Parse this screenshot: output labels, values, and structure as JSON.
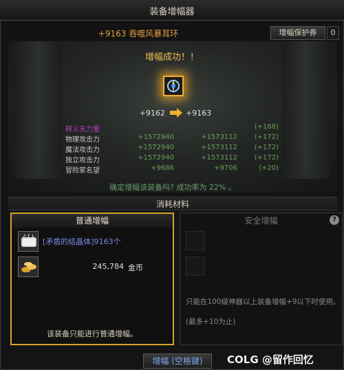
{
  "window": {
    "title": "装备增幅器"
  },
  "item": {
    "name": "+9163 吞噬风暴耳环",
    "success_text": "增幅成功！！",
    "level_old": "+9162",
    "level_new": "+9163"
  },
  "protect": {
    "label": "增幅保护券",
    "count": "0"
  },
  "stats": [
    {
      "name": "释义无力量",
      "old": "",
      "new": "",
      "diff": "(+168)"
    },
    {
      "name": "物理攻击力",
      "old": "+1572940",
      "new": "+1573112",
      "diff": "(+172)"
    },
    {
      "name": "魔法攻击力",
      "old": "+1572940",
      "new": "+1573112",
      "diff": "(+172)"
    },
    {
      "name": "独立攻击力",
      "old": "+1572940",
      "new": "+1573112",
      "diff": "(+172)"
    },
    {
      "name": "冒险家名望",
      "old": "+9686",
      "new": "+9706",
      "diff": "(+20)"
    }
  ],
  "confirm_text": "确定增幅该装备吗? 成功率为 22% 。",
  "materials": {
    "section_title": "消耗材料",
    "normal": {
      "title": "普通增幅",
      "mat1_name": "[矛盾的结晶体]9163个",
      "mat2_amount": "245,784",
      "mat2_unit": "金币",
      "note": "该装备只能进行普通增幅。"
    },
    "safe": {
      "title": "安全增幅",
      "help": "?",
      "note1": "只能在100级神器以上装备增幅+9以下时使用。",
      "note2": "(最多+10为止)"
    }
  },
  "button": {
    "upgrade": "增幅 (空格键)"
  },
  "watermark": "COLG @留作回忆",
  "icons": {
    "item": "earring-icon",
    "material1": "crystal-icon",
    "material2": "gold-coins-icon"
  }
}
